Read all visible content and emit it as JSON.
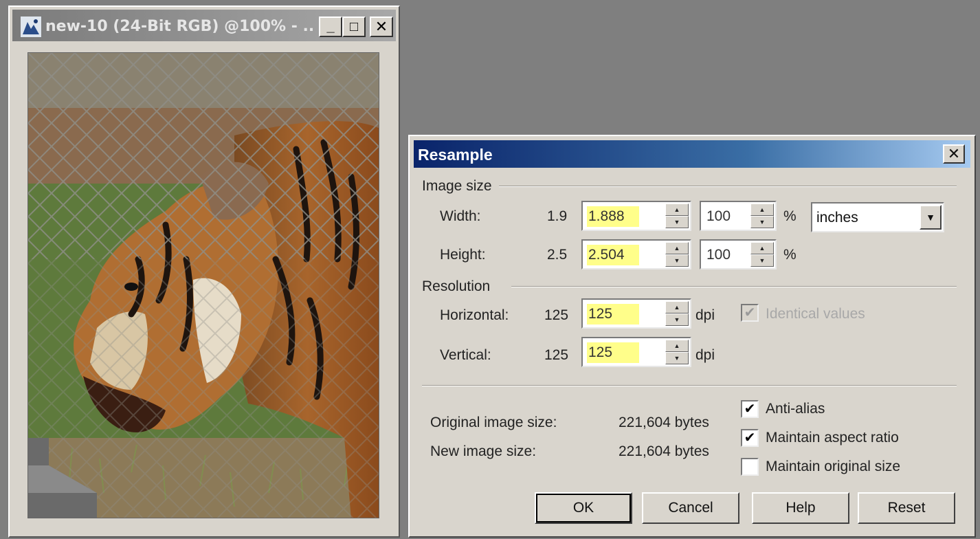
{
  "document_window": {
    "title": "new-10 (24-Bit RGB) @100% - ...",
    "minimize_label": "_",
    "maximize_label": "□",
    "close_label": "✕"
  },
  "dialog": {
    "title": "Resample",
    "close_label": "✕",
    "image_size": {
      "group_label": "Image size",
      "width": {
        "label": "Width:",
        "original": "1.9",
        "value": "1.888",
        "percent": "100",
        "percent_unit": "%",
        "unit_selected": "inches"
      },
      "height": {
        "label": "Height:",
        "original": "2.5",
        "value": "2.504",
        "percent": "100",
        "percent_unit": "%"
      }
    },
    "resolution": {
      "group_label": "Resolution",
      "horizontal": {
        "label": "Horizontal:",
        "original": "125",
        "value": "125",
        "unit": "dpi"
      },
      "vertical": {
        "label": "Vertical:",
        "original": "125",
        "value": "125",
        "unit": "dpi"
      },
      "identical_values": {
        "label": "Identical values",
        "checked": true,
        "enabled": false
      }
    },
    "info": {
      "original_size_label": "Original image size:",
      "original_size_value": "221,604 bytes",
      "new_size_label": "New image size:",
      "new_size_value": "221,604 bytes"
    },
    "options": {
      "anti_alias": {
        "label": "Anti-alias",
        "checked": true
      },
      "maintain_aspect": {
        "label": "Maintain aspect ratio",
        "checked": true
      },
      "maintain_original": {
        "label": "Maintain original size",
        "checked": false
      }
    },
    "buttons": {
      "ok": "OK",
      "cancel": "Cancel",
      "help": "Help",
      "reset": "Reset"
    }
  },
  "colors": {
    "desktop": "#7f7f7f",
    "dialog_title_start": "#0a246a",
    "dialog_title_end": "#a6caf0",
    "field_highlight": "#fffe8a"
  }
}
